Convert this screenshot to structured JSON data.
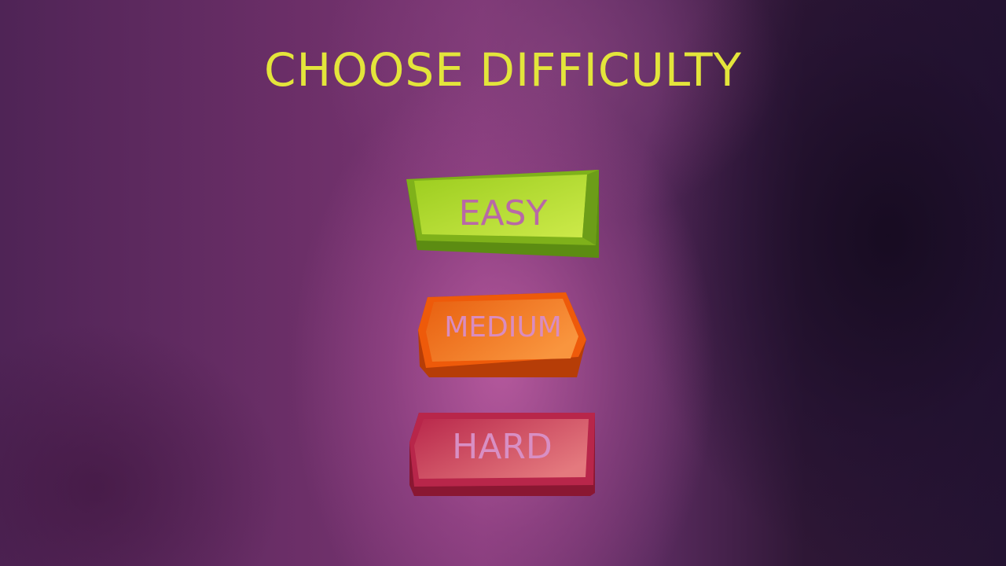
{
  "screen": {
    "title": "CHOOSE DIFFICULTY"
  },
  "buttons": {
    "easy": {
      "label": "EASY",
      "color": "#a7d422"
    },
    "medium": {
      "label": "MEDIUM",
      "color": "#ee6a12"
    },
    "hard": {
      "label": "HARD",
      "color": "#c32c4e"
    }
  },
  "colors": {
    "title": "#e3e53b",
    "background": "#6c2f68"
  }
}
